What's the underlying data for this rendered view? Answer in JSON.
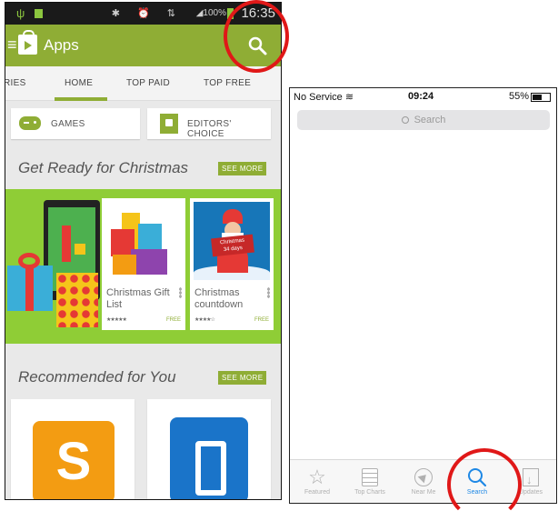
{
  "android": {
    "status": {
      "time": "16:35",
      "battery": "100%"
    },
    "appbar": {
      "title": "Apps"
    },
    "tabs": [
      "RIES",
      "HOME",
      "TOP PAID",
      "TOP FREE"
    ],
    "active_tab": "HOME",
    "shortcuts": {
      "games": "GAMES",
      "editors": "EDITORS' CHOICE"
    },
    "section1": {
      "title": "Get Ready for Christmas",
      "see_more": "SEE MORE"
    },
    "apps": [
      {
        "name": "Christmas Gift List",
        "stars": "★★★★★",
        "price": "FREE"
      },
      {
        "name": "Christmas countdown",
        "stars": "★★★★☆",
        "price": "FREE"
      }
    ],
    "santa_sign": "Christmas\n34 days",
    "section2": {
      "title": "Recommended for You",
      "see_more": "SEE MORE"
    },
    "rec_icons": [
      "S",
      "0"
    ]
  },
  "iphone": {
    "status": {
      "carrier": "No Service",
      "time": "09:24",
      "battery": "55%"
    },
    "search_placeholder": "Search",
    "tabs": [
      {
        "label": "Featured",
        "icon": "star-icon"
      },
      {
        "label": "Top Charts",
        "icon": "list-icon"
      },
      {
        "label": "Near Me",
        "icon": "location-icon"
      },
      {
        "label": "Search",
        "icon": "search-icon"
      },
      {
        "label": "Updates",
        "icon": "download-icon"
      }
    ],
    "active_tab": "Search"
  },
  "colors": {
    "android_green": "#8fad35",
    "annotation_red": "#e01818",
    "ios_blue": "#1e88e5"
  }
}
